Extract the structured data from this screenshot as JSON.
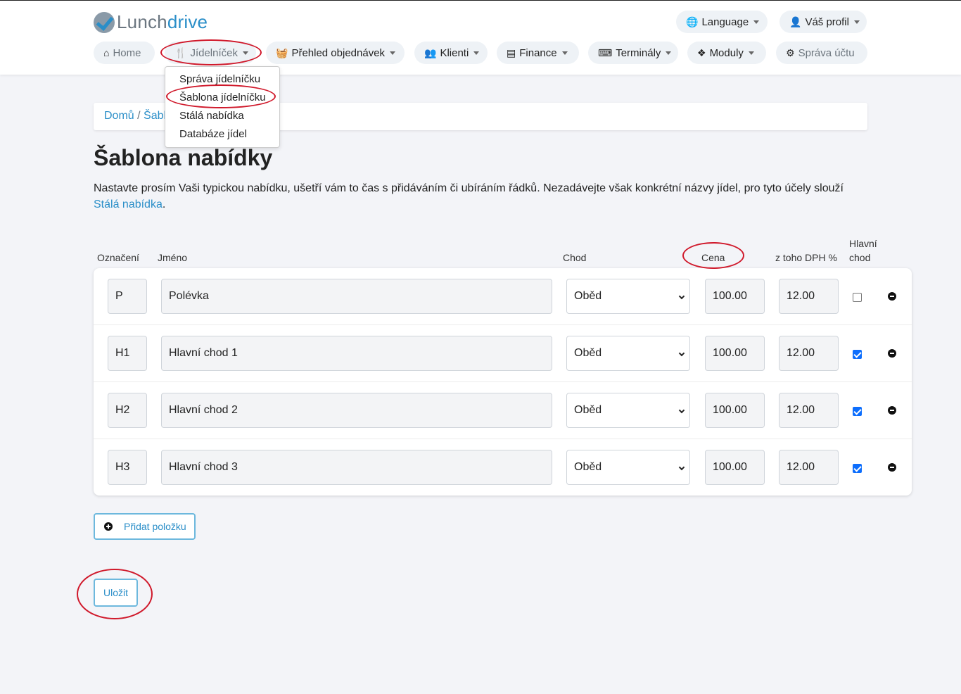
{
  "brand": {
    "part1": "Lunch",
    "part2": "drive"
  },
  "top_menu": {
    "language": "Language",
    "profile": "Váš profil"
  },
  "nav": {
    "home": "Home",
    "menu": "Jídelníček",
    "orders": "Přehled objednávek",
    "clients": "Klienti",
    "finance": "Finance",
    "terminals": "Terminály",
    "modules": "Moduly",
    "account": "Správa účtu"
  },
  "menu_dropdown": {
    "items": [
      "Správa jídelníčku",
      "Šablona jídelníčku",
      "Stálá nabídka",
      "Databáze jídel"
    ]
  },
  "breadcrumb": {
    "home": "Domů",
    "separator": "/",
    "current_partial": "Šabl"
  },
  "page": {
    "title": "Šablona nabídky",
    "intro": "Nastavte prosím Vaši typickou nabídku, ušetří vám to čas s přidáváním či ubíráním řádků. Nezadávejte však konkrétní názvy jídel, pro tyto účely slouží",
    "intro_link": "Stálá nabídka",
    "intro_end": "."
  },
  "table": {
    "headers": {
      "label": "Označení",
      "name": "Jméno",
      "course": "Chod",
      "price": "Cena",
      "vat": "z toho DPH %",
      "main_line1": "Hlavní",
      "main_line2": "chod"
    },
    "rows": [
      {
        "label": "P",
        "name": "Polévka",
        "course": "Oběd",
        "price": "100.00",
        "vat": "12.00",
        "main": false
      },
      {
        "label": "H1",
        "name": "Hlavní chod 1",
        "course": "Oběd",
        "price": "100.00",
        "vat": "12.00",
        "main": true
      },
      {
        "label": "H2",
        "name": "Hlavní chod 2",
        "course": "Oběd",
        "price": "100.00",
        "vat": "12.00",
        "main": true
      },
      {
        "label": "H3",
        "name": "Hlavní chod 3",
        "course": "Oběd",
        "price": "100.00",
        "vat": "12.00",
        "main": true
      }
    ]
  },
  "actions": {
    "add_item": "Přidat položku",
    "save": "Uložit"
  },
  "colors": {
    "accent": "#2a8ec8",
    "annotation": "#d0192b",
    "checkbox": "#0d6efd"
  }
}
